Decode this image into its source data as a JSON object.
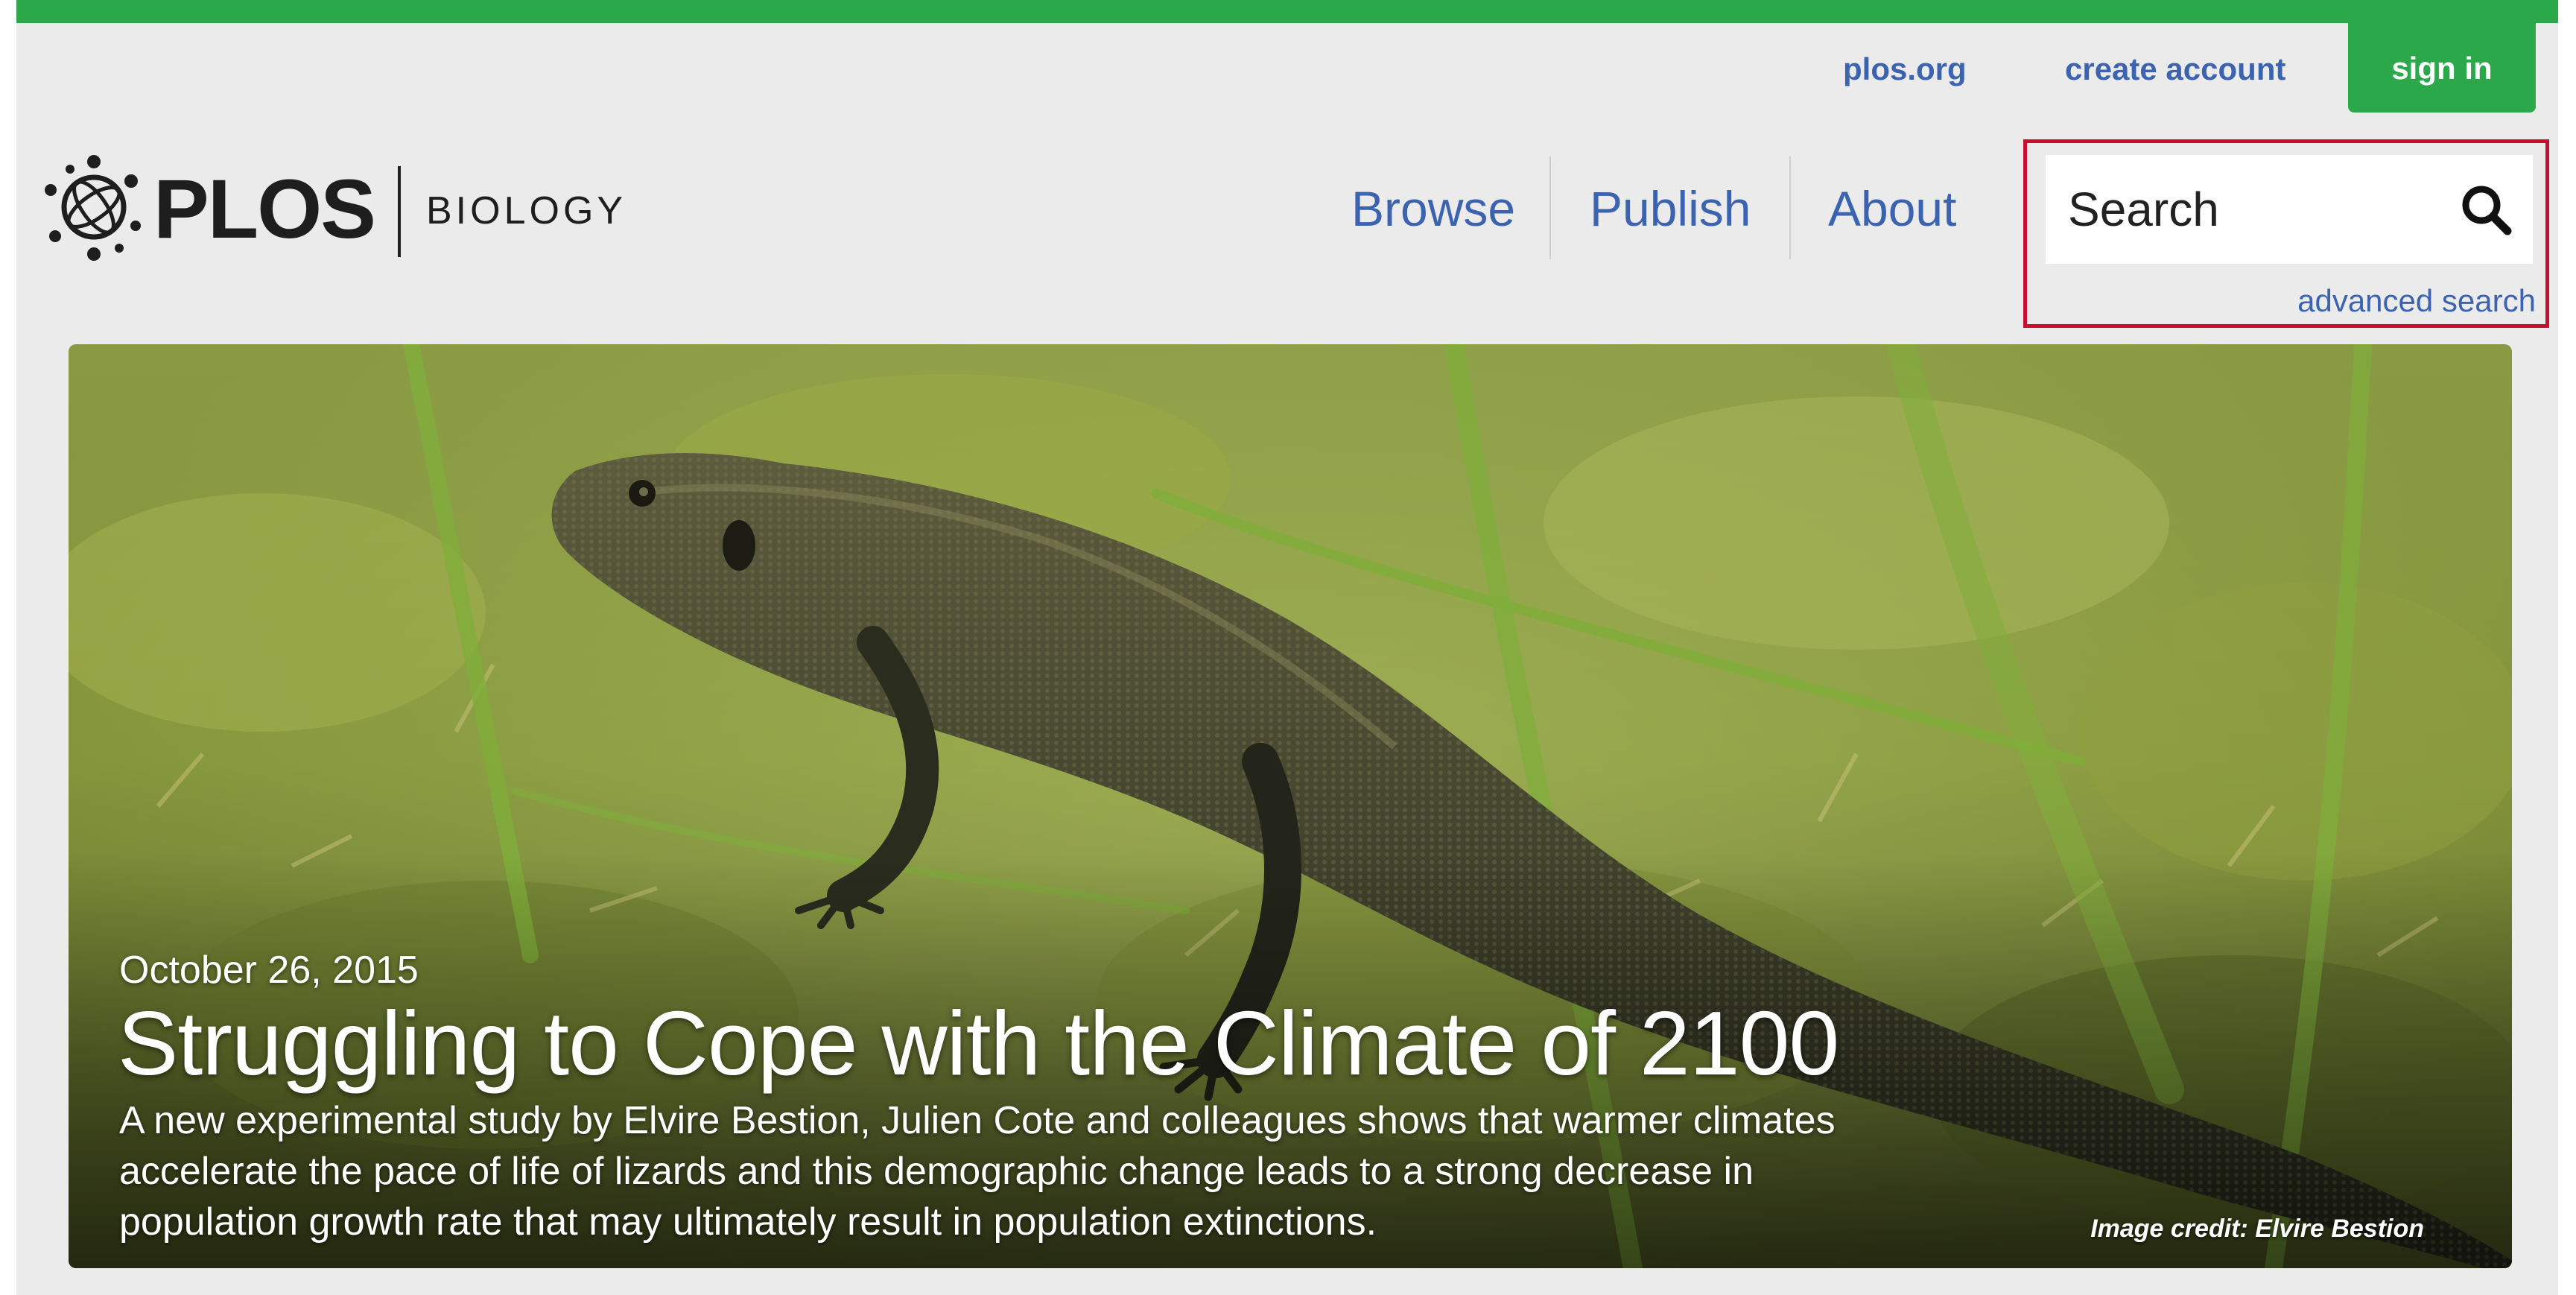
{
  "utility_nav": {
    "plos_org": "plos.org",
    "create_account": "create account",
    "sign_in": "sign in"
  },
  "logo": {
    "wordmark": "PLOS",
    "journal": "BIOLOGY"
  },
  "main_nav": {
    "items": [
      {
        "label": "Browse"
      },
      {
        "label": "Publish"
      },
      {
        "label": "About"
      }
    ]
  },
  "search": {
    "placeholder": "Search",
    "advanced_label": "advanced search",
    "highlight_color": "#c8102e"
  },
  "hero": {
    "date": "October 26, 2015",
    "title": "Struggling to Cope with the Climate of 2100",
    "description": "A new experimental study by Elvire Bestion, Julien Cote and colleagues shows that warmer climates accelerate the pace of life of lizards and this demographic change leads to a strong decrease in population growth rate that may ultimately result in population extinctions.",
    "image_credit": "Image credit: Elvire Bestion"
  },
  "colors": {
    "brand_green": "#2ba84a",
    "link_blue": "#3c63af",
    "page_bg": "#ebebeb"
  }
}
